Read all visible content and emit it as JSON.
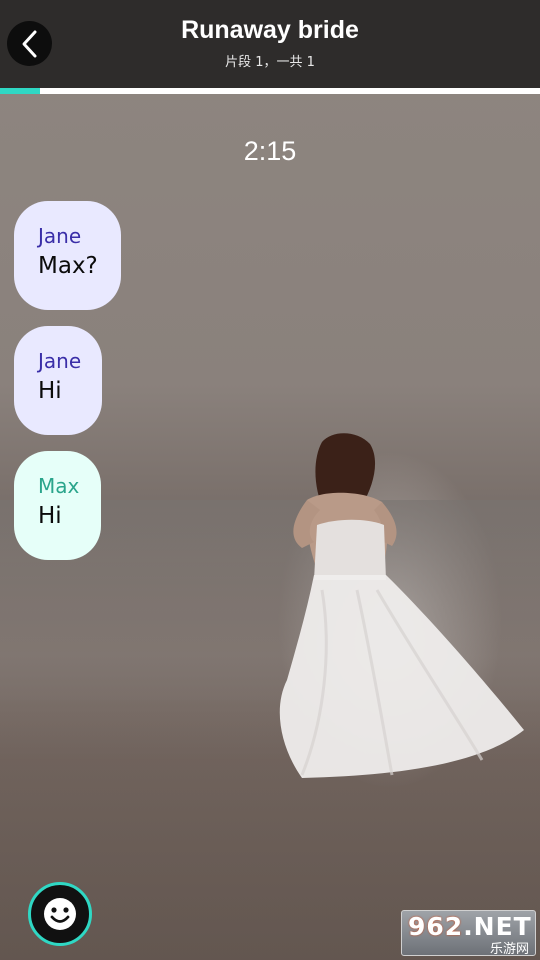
{
  "header": {
    "title": "Runaway bride",
    "subtitle": "片段 1，一共 1",
    "progress": 0.074
  },
  "timestamp": "2:15",
  "messages": [
    {
      "sender": "Jane",
      "text": "Max?"
    },
    {
      "sender": "Jane",
      "text": "Hi"
    },
    {
      "sender": "Max",
      "text": "Hi"
    }
  ],
  "watermark": {
    "main_num": "962",
    "main_suffix": ".NET",
    "sub": "乐游网"
  },
  "colors": {
    "accent": "#2fd8c4",
    "jane_bubble": "#e9e9ff",
    "max_bubble": "#e6fff9",
    "jane_name": "#3a2ea8",
    "max_name": "#2aa58c"
  },
  "icons": {
    "back": "chevron-left-icon",
    "emoji": "smiley-face-icon"
  }
}
